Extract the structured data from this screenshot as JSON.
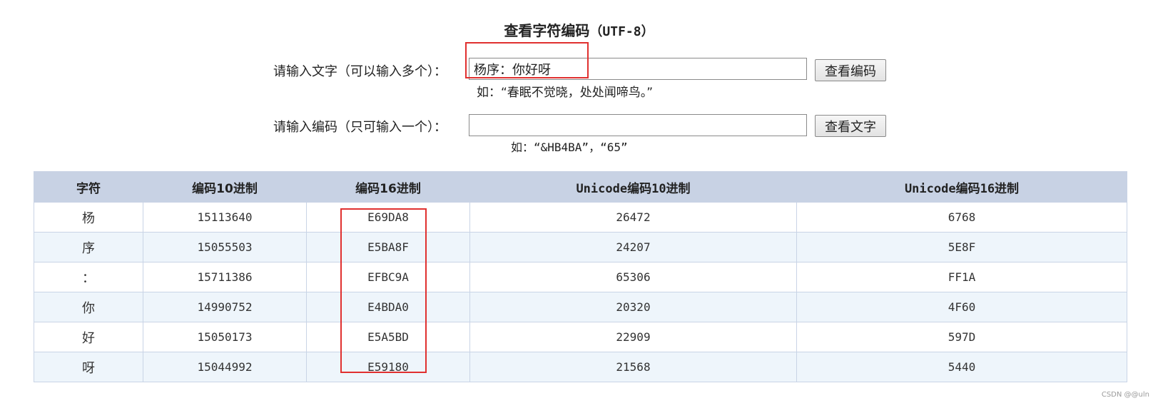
{
  "title": {
    "main": "查看字符编码",
    "suffix": "（UTF-8）"
  },
  "text_form": {
    "label": "请输入文字（可以输入多个）：",
    "value": "杨序：你好呀",
    "button": "查看编码",
    "hint": "如：“春眠不觉晓，处处闻啼鸟。”"
  },
  "code_form": {
    "label": "请输入编码（只可输入一个）：",
    "value": "",
    "button": "查看文字",
    "hint": "如：“&HB4BA”，“65”"
  },
  "table": {
    "headers": [
      "字符",
      "编码10进制",
      "编码16进制",
      "Unicode编码10进制",
      "Unicode编码16进制"
    ],
    "rows": [
      [
        "杨",
        "15113640",
        "E69DA8",
        "26472",
        "6768"
      ],
      [
        "序",
        "15055503",
        "E5BA8F",
        "24207",
        "5E8F"
      ],
      [
        "：",
        "15711386",
        "EFBC9A",
        "65306",
        "FF1A"
      ],
      [
        "你",
        "14990752",
        "E4BDA0",
        "20320",
        "4F60"
      ],
      [
        "好",
        "15050173",
        "E5A5BD",
        "22909",
        "597D"
      ],
      [
        "呀",
        "15044992",
        "E59180",
        "21568",
        "5440"
      ]
    ]
  },
  "watermark": "CSDN @@uln",
  "colors": {
    "header_bg": "#c8d2e4",
    "alt_row_bg": "#eef5fb",
    "highlight_box": "#e0302f"
  }
}
